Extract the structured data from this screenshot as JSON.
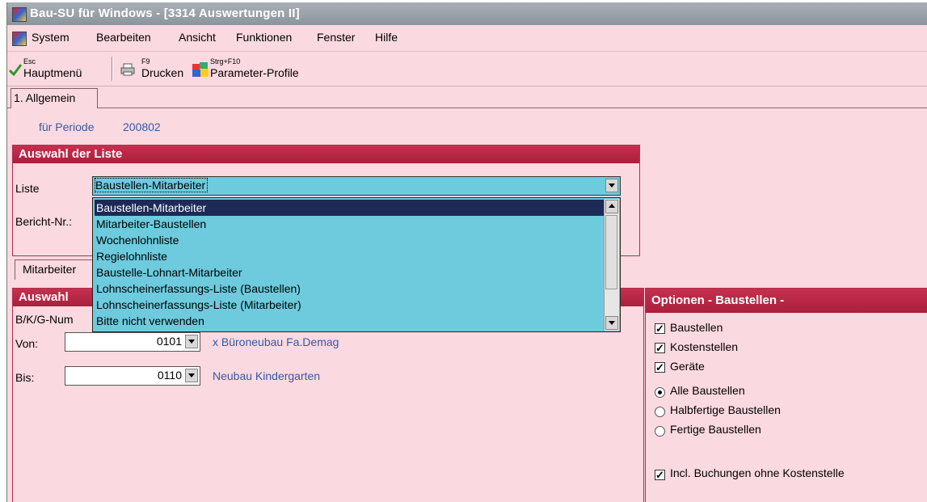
{
  "window": {
    "title": "Bau-SU für Windows - [3314 Auswertungen II]"
  },
  "menu": [
    "System",
    "Bearbeiten",
    "Ansicht",
    "Funktionen",
    "Fenster",
    "Hilfe"
  ],
  "toolbar": {
    "home": {
      "shortcut": "Esc",
      "label": "Hauptmenü"
    },
    "print": {
      "shortcut": "F9",
      "label": "Drucken"
    },
    "profiles": {
      "shortcut": "Strg+F10",
      "label": "Parameter-Profile"
    }
  },
  "tabs": {
    "main": "1. Allgemein",
    "sub": "Mitarbeiter"
  },
  "period": {
    "label": "für Periode",
    "value": "200802"
  },
  "auswahl_liste": {
    "title": "Auswahl der Liste",
    "liste_label": "Liste",
    "liste_value": "Baustellen-Mitarbeiter",
    "bericht_label": "Bericht-Nr.:",
    "options": [
      "Baustellen-Mitarbeiter",
      "Mitarbeiter-Baustellen",
      "Wochenlohnliste",
      "Regielohnliste",
      "Baustelle-Lohnart-Mitarbeiter",
      "Lohnscheinerfassungs-Liste (Baustellen)",
      "Lohnscheinerfassungs-Liste (Mitarbeiter)",
      "Bitte nicht verwenden"
    ]
  },
  "auswahl2": {
    "title": "Auswahl",
    "subheader": "B/K/G-Num",
    "von_label": "Von:",
    "von_value": "0101",
    "von_desc": "x Büroneubau Fa.Demag",
    "bis_label": "Bis:",
    "bis_value": "0110",
    "bis_desc": "Neubau Kindergarten"
  },
  "optionen": {
    "title": "Optionen - Baustellen -",
    "checks": [
      {
        "label": "Baustellen",
        "checked": true
      },
      {
        "label": "Kostenstellen",
        "checked": true
      },
      {
        "label": "Geräte",
        "checked": true
      }
    ],
    "radios": [
      {
        "label": "Alle Baustellen",
        "selected": true
      },
      {
        "label": "Halbfertige Baustellen",
        "selected": false
      },
      {
        "label": "Fertige Baustellen",
        "selected": false
      }
    ],
    "incl": {
      "label": "Incl. Buchungen ohne Kostenstelle",
      "checked": true
    }
  },
  "colors": {
    "bg": "#fbd9e0",
    "header": "#c7304f",
    "list": "#6dcbdd",
    "selection": "#1e2a56",
    "link": "#3359a8"
  },
  "icons": {
    "home": "green-check-icon",
    "print": "printer-icon",
    "profiles": "profiles-icon"
  }
}
